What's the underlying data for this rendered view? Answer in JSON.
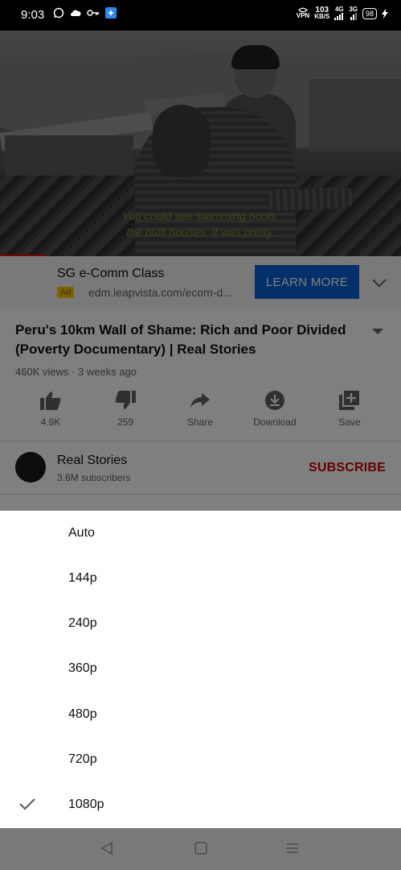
{
  "status_bar": {
    "time": "9:03",
    "net_speed_value": "103",
    "net_speed_unit": "KB/S",
    "signal_label": "4G",
    "signal_label_2": "3G",
    "battery": "98",
    "vpn_label": "VPN"
  },
  "video": {
    "subtitle_line1": "You could see swimming pools,",
    "subtitle_line2": "the built houses. It was pretty."
  },
  "ad": {
    "title": "SG e-Comm Class",
    "badge": "Ad",
    "url": "edm.leapvista.com/ecom-d...",
    "cta": "LEARN MORE"
  },
  "video_info": {
    "title": "Peru's 10km Wall of Shame: Rich and Poor Divided (Poverty Documentary) | Real Stories",
    "meta": "460K views · 3 weeks ago"
  },
  "actions": [
    {
      "label": "4.9K",
      "icon": "thumbs-up-icon"
    },
    {
      "label": "259",
      "icon": "thumbs-down-icon"
    },
    {
      "label": "Share",
      "icon": "share-icon"
    },
    {
      "label": "Download",
      "icon": "download-icon"
    },
    {
      "label": "Save",
      "icon": "save-to-playlist-icon"
    }
  ],
  "channel": {
    "name": "Real Stories",
    "subscribers": "3.6M subscribers",
    "subscribe_label": "SUBSCRIBE"
  },
  "quality_menu": {
    "options": [
      "Auto",
      "144p",
      "240p",
      "360p",
      "480p",
      "720p",
      "1080p"
    ],
    "selected": "1080p"
  },
  "colors": {
    "accent_blue": "#065fd4",
    "subscribe_red": "#cc0000",
    "progress_red": "#ff0000"
  }
}
